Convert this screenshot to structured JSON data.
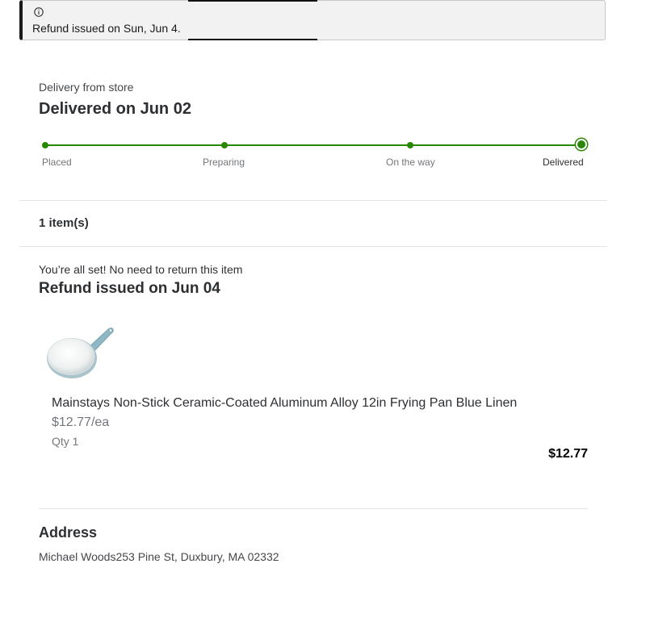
{
  "alert": {
    "icon": "info-icon",
    "message": "Refund issued on Sun, Jun 4."
  },
  "delivery": {
    "subtitle": "Delivery from store",
    "title": "Delivered on Jun 02",
    "accent_color": "#2a8703",
    "steps": [
      {
        "label": "Placed",
        "status": "complete"
      },
      {
        "label": "Preparing",
        "status": "complete"
      },
      {
        "label": "On the way",
        "status": "complete"
      },
      {
        "label": "Delivered",
        "status": "current"
      }
    ]
  },
  "items": {
    "count_label": "1 item(s)"
  },
  "refund": {
    "note": "You’re all set! No need to return this item",
    "title": "Refund issued on Jun 04"
  },
  "product": {
    "image_icon": "frying-pan-image",
    "name": "Mainstays Non-Stick Ceramic-Coated Aluminum Alloy 12in Frying Pan Blue Linen",
    "unit_price": "$12.77/ea",
    "qty": "Qty 1",
    "total": "$12.77"
  },
  "address": {
    "title": "Address",
    "text": "Michael Woods253 Pine St, Duxbury, MA 02332"
  }
}
